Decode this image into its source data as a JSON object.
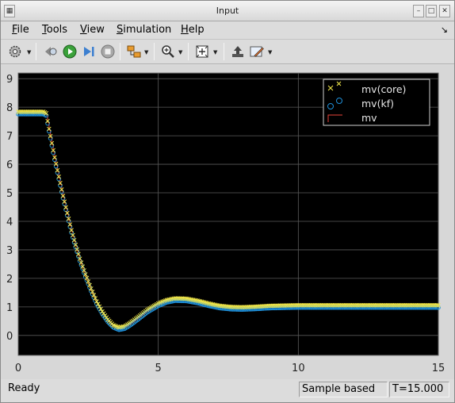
{
  "window": {
    "title": "Input"
  },
  "menu": {
    "file": "File",
    "tools": "Tools",
    "view": "View",
    "simulation": "Simulation",
    "help": "Help"
  },
  "menu_mnemonics": {
    "file": "F",
    "tools": "T",
    "view": "V",
    "simulation": "S",
    "help": "H"
  },
  "toolbar": {
    "icons": [
      "gear-icon",
      "highlight-model-icon",
      "run-icon",
      "step-forward-icon",
      "stop-icon",
      "signal-selector-icon",
      "zoom-icon",
      "fit-to-view-icon",
      "restore-settings-icon",
      "style-icon"
    ]
  },
  "status": {
    "ready": "Ready",
    "mode": "Sample based",
    "time": "T=15.000"
  },
  "colors": {
    "plot_background": "#000000",
    "axes_area": "#d7d7d7",
    "grid": "#5a5a5a",
    "core_marker": "#f2e84b",
    "kf_marker": "#1f8fd8",
    "mv_line": "#e8443a",
    "tick_text": "#d0d0d0"
  },
  "chart_data": {
    "type": "scatter",
    "xlim": [
      0,
      15
    ],
    "ylim": [
      -0.7,
      9.2
    ],
    "x_ticks": [
      "0",
      "5",
      "10",
      "15"
    ],
    "y_ticks": [
      "0",
      "1",
      "2",
      "3",
      "4",
      "5",
      "6",
      "7",
      "8",
      "9"
    ],
    "grid": true,
    "legend_position": "top-right",
    "series": [
      {
        "name": "mv(core)",
        "marker": "x"
      },
      {
        "name": "mv(kf)",
        "marker": "o"
      },
      {
        "name": "mv",
        "marker": "step-line"
      }
    ],
    "x": [
      0,
      0.5,
      0.9,
      1.0,
      1.1,
      1.2,
      1.3,
      1.4,
      1.5,
      1.6,
      1.7,
      1.8,
      1.9,
      2.0,
      2.2,
      2.4,
      2.6,
      2.8,
      3.0,
      3.2,
      3.4,
      3.6,
      3.8,
      4.0,
      4.3,
      4.6,
      5.0,
      5.3,
      5.6,
      6.0,
      6.4,
      6.8,
      7.2,
      7.6,
      8.0,
      8.5,
      9.0,
      10.0,
      11.0,
      12.0,
      13.0,
      14.0,
      15.0
    ],
    "y": [
      7.8,
      7.8,
      7.8,
      7.75,
      7.2,
      6.7,
      6.2,
      5.75,
      5.3,
      4.85,
      4.45,
      4.05,
      3.65,
      3.3,
      2.65,
      2.1,
      1.6,
      1.15,
      0.8,
      0.52,
      0.32,
      0.24,
      0.28,
      0.4,
      0.62,
      0.85,
      1.08,
      1.2,
      1.26,
      1.25,
      1.18,
      1.08,
      1.0,
      0.96,
      0.95,
      0.97,
      1.0,
      1.02,
      1.02,
      1.02,
      1.02,
      1.02,
      1.02
    ]
  }
}
